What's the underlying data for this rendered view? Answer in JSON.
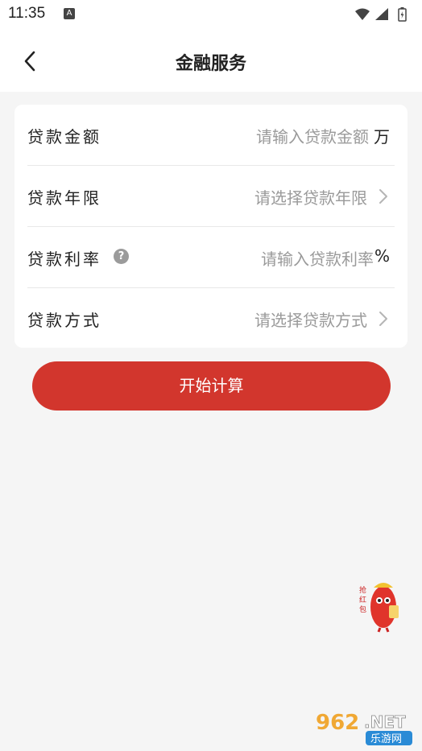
{
  "status_bar": {
    "time": "11:35",
    "notification_icon": "a-icon",
    "icons": [
      "wifi-icon",
      "cell-signal-icon",
      "battery-charging-icon"
    ]
  },
  "nav": {
    "title": "金融服务",
    "back_icon": "chevron-left-icon"
  },
  "form": {
    "rows": [
      {
        "label": "贷款金额",
        "placeholder": "请输入贷款金额",
        "unit": "万"
      },
      {
        "label": "贷款年限",
        "placeholder": "请选择贷款年限",
        "trailing_icon": "chevron-right-icon"
      },
      {
        "label": "贷款利率",
        "placeholder": "请输入贷款利率",
        "unit": "%",
        "help_icon": "question-icon"
      },
      {
        "label": "贷款方式",
        "placeholder": "请选择贷款方式",
        "trailing_icon": "chevron-right-icon"
      }
    ]
  },
  "start_button": {
    "label": "开始计算"
  },
  "floating": {
    "icon": "red-packet-mascot-icon",
    "text": "抢红包"
  },
  "watermark": {
    "brand": "962.NET",
    "sub": "乐游网"
  },
  "colors": {
    "accent": "#d2362d",
    "background": "#f5f5f5",
    "card": "#ffffff",
    "placeholder": "#9a9a9a"
  }
}
